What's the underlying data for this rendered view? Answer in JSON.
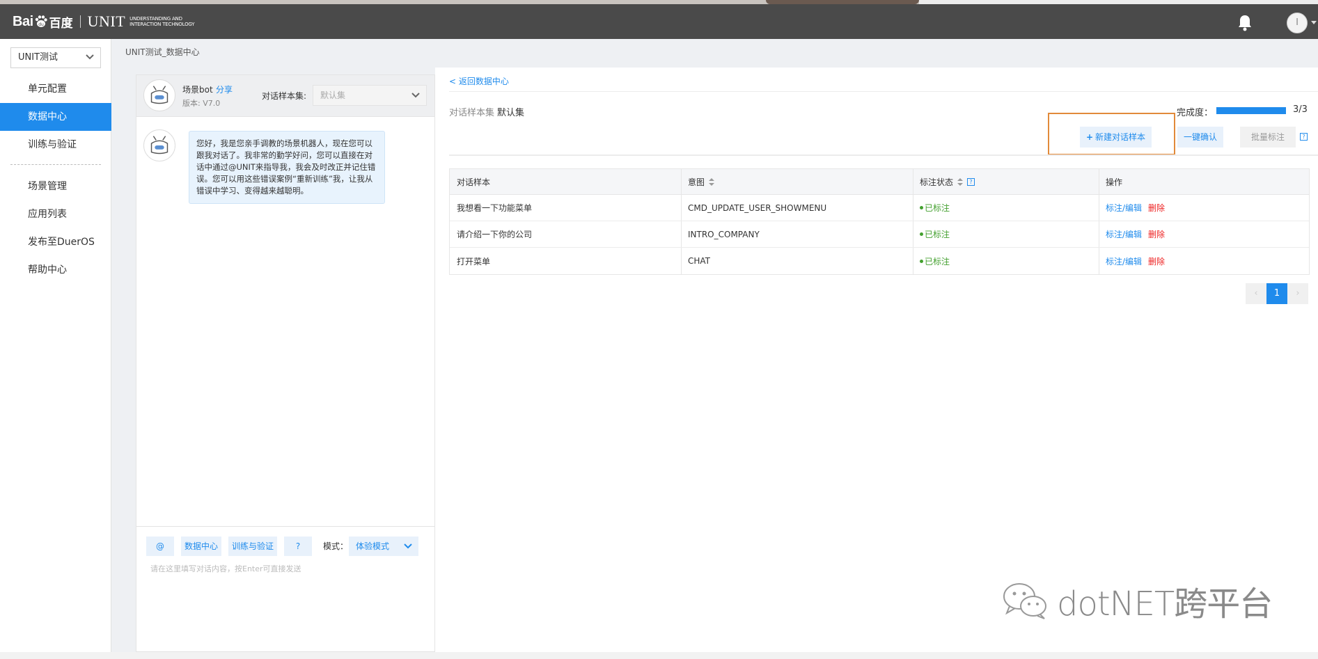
{
  "app": {
    "logo_bai": "Bai",
    "logo_cn": "百度",
    "logo_unit": "UNIT",
    "logo_tagline_1": "Understanding and",
    "logo_tagline_2": "Interaction Technology",
    "avatar_initial": "I"
  },
  "sidebar": {
    "project_select": "UNIT测试",
    "items": [
      {
        "label": "单元配置"
      },
      {
        "label": "数据中心",
        "active": true
      },
      {
        "label": "训练与验证"
      },
      {
        "label": "场景管理"
      },
      {
        "label": "应用列表"
      },
      {
        "label": "发布至DuerOS"
      },
      {
        "label": "帮助中心"
      }
    ]
  },
  "breadcrumb": "UNIT测试_数据中心",
  "chat": {
    "bot_name": "场景bot",
    "share": "分享",
    "version": "版本: V7.0",
    "dataset_label": "对话样本集:",
    "dataset_placeholder": "默认集",
    "message": "您好，我是您亲手调教的场景机器人，现在您可以跟我对话了。我非常的勤学好问，您可以直接在对话中通过@UNIT来指导我，我会及时改正并记住错误。您可以用这些错误案例“重新训练”我，让我从错误中学习、变得越来越聪明。",
    "tools": {
      "at": "@",
      "data_center": "数据中心",
      "train": "训练与验证",
      "help": "?"
    },
    "mode_label": "模式：",
    "mode_value": "体验模式",
    "input_placeholder": "请在这里填写对话内容，按Enter可直接发送"
  },
  "main": {
    "back_link": "< 返回数据中心",
    "dataset_label": "对话样本集",
    "dataset_name": "默认集",
    "completion_label": "完成度：",
    "completion_count": "3/3",
    "completion_fraction": 1.0,
    "buttons": {
      "new_sample": "新建对话样本",
      "confirm_all": "一键确认",
      "batch_label": "批量标注",
      "help": "?"
    },
    "table": {
      "headers": [
        "对话样本",
        "意图",
        "标注状态",
        "操作"
      ],
      "rows": [
        {
          "sample": "我想看一下功能菜单",
          "intent": "CMD_UPDATE_USER_SHOWMENU",
          "status": "已标注",
          "edit": "标注/编辑",
          "delete": "删除"
        },
        {
          "sample": "请介绍一下你的公司",
          "intent": "INTRO_COMPANY",
          "status": "已标注",
          "edit": "标注/编辑",
          "delete": "删除"
        },
        {
          "sample": "打开菜单",
          "intent": "CHAT",
          "status": "已标注",
          "edit": "标注/编辑",
          "delete": "删除"
        }
      ]
    },
    "pager": {
      "prev": "‹",
      "current": "1",
      "next": "›"
    }
  },
  "watermark": "dotNET跨平台",
  "colors": {
    "accent": "#1f8bec",
    "header": "#4a4a4a",
    "success": "#43a02e",
    "danger": "#e22222",
    "highlight": "#e28a3a"
  }
}
